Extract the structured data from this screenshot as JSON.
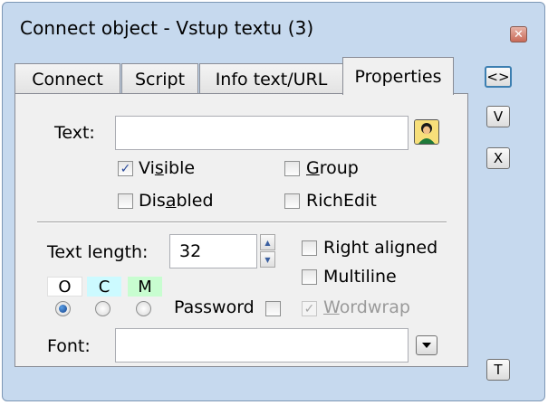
{
  "window": {
    "title": "Connect object - Vstup textu (3)",
    "close_label": "✕"
  },
  "tabs": [
    {
      "label": "Connect"
    },
    {
      "label": "Script"
    },
    {
      "label": "Info text/URL"
    },
    {
      "label": "Properties"
    }
  ],
  "side_buttons": {
    "swap": "<>",
    "v": "V",
    "x": "X",
    "t": "T"
  },
  "text_field": {
    "label": "Text:",
    "value": ""
  },
  "checkboxes": {
    "visible": {
      "label_pre": "Vi",
      "label_u": "s",
      "label_post": "ible",
      "checked": true
    },
    "group": {
      "label_pre": "",
      "label_u": "G",
      "label_post": "roup",
      "checked": false
    },
    "disabled": {
      "label_pre": "Dis",
      "label_u": "a",
      "label_post": "bled",
      "checked": false
    },
    "richedit": {
      "label": "RichEdit",
      "checked": false
    },
    "right_aligned": {
      "label": "Right aligned",
      "checked": false
    },
    "multiline": {
      "label": "Multiline",
      "checked": false
    },
    "password": {
      "label": "Password",
      "checked": false
    },
    "wordwrap": {
      "label_u": "W",
      "label_post": "ordwrap",
      "checked": true,
      "enabled": false
    }
  },
  "text_length": {
    "label": "Text length:",
    "value": "32"
  },
  "modes": [
    {
      "label": "O",
      "color": "#ffffff",
      "selected": true
    },
    {
      "label": "C",
      "color": "#ccfaff",
      "selected": false
    },
    {
      "label": "M",
      "color": "#c8fdd0",
      "selected": false
    }
  ],
  "font": {
    "label": "Font:",
    "value": ""
  },
  "icons": {
    "text_expr": "person-icon",
    "font_dropdown": "chevron-down-icon",
    "spin_up": "up-arrow-icon",
    "spin_down": "down-arrow-icon"
  }
}
